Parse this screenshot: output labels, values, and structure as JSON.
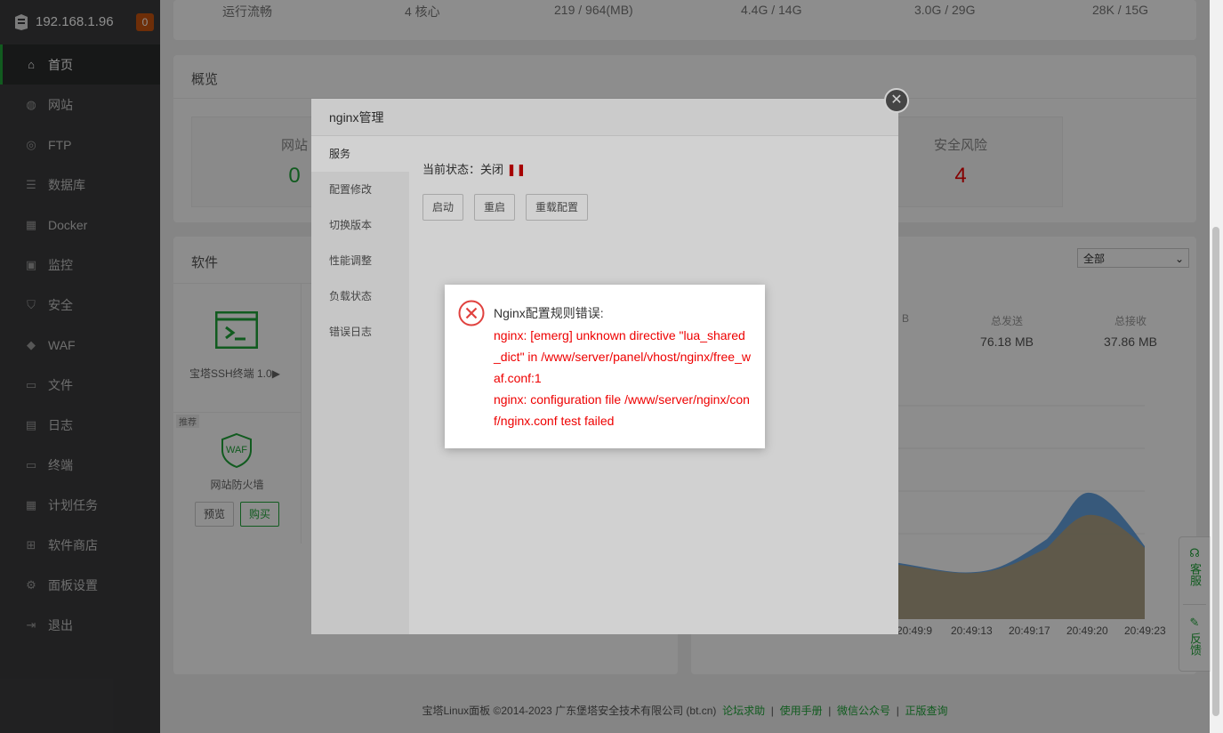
{
  "sidebar": {
    "host": "192.168.1.96",
    "badge": "0",
    "items": [
      {
        "label": "首页",
        "icon": "home-icon"
      },
      {
        "label": "网站",
        "icon": "globe-icon"
      },
      {
        "label": "FTP",
        "icon": "ftp-icon"
      },
      {
        "label": "数据库",
        "icon": "database-icon"
      },
      {
        "label": "Docker",
        "icon": "docker-icon"
      },
      {
        "label": "监控",
        "icon": "monitor-icon"
      },
      {
        "label": "安全",
        "icon": "shield-icon"
      },
      {
        "label": "WAF",
        "icon": "waf-icon"
      },
      {
        "label": "文件",
        "icon": "folder-icon"
      },
      {
        "label": "日志",
        "icon": "log-icon"
      },
      {
        "label": "终端",
        "icon": "terminal-icon"
      },
      {
        "label": "计划任务",
        "icon": "calendar-icon"
      },
      {
        "label": "软件商店",
        "icon": "apps-icon"
      },
      {
        "label": "面板设置",
        "icon": "gear-icon"
      },
      {
        "label": "退出",
        "icon": "logout-icon"
      }
    ]
  },
  "sysinfo": {
    "status": "运行流畅",
    "cpu": "4 核心",
    "memory": "219 / 964(MB)",
    "disk1": "4.4G / 14G",
    "disk2": "3.0G / 29G",
    "disk3": "28K / 15G"
  },
  "overview": {
    "title": "概览",
    "sites_label": "网站",
    "sites_value": "0",
    "risk_label": "安全风险",
    "risk_value": "4"
  },
  "software": {
    "title": "软件",
    "ssh_name": "宝塔SSH终端 1.0▶",
    "recommend_tag": "推荐",
    "waf_name": "网站防火墙",
    "preview_btn": "预览",
    "buy_btn": "购买"
  },
  "traffic": {
    "filter": "全部",
    "sent_label": "总发送",
    "sent_value": "76.18 MB",
    "recv_label": "总接收",
    "recv_value": "37.86 MB",
    "partial_value": "B",
    "times": [
      "20:49:9",
      "20:49:13",
      "20:49:17",
      "20:49:20",
      "20:49:23"
    ]
  },
  "modal": {
    "title": "nginx管理",
    "tabs": [
      "服务",
      "配置修改",
      "切换版本",
      "性能调整",
      "负载状态",
      "错误日志"
    ],
    "status_label": "当前状态：关闭",
    "buttons": [
      "启动",
      "重启",
      "重载配置"
    ]
  },
  "error": {
    "title": "Nginx配置规则错误:",
    "line1": "nginx: [emerg] unknown directive \"lua_shared_dict\" in /www/server/panel/vhost/nginx/free_waf.conf:1",
    "line2": "nginx: configuration file /www/server/nginx/conf/nginx.conf test failed"
  },
  "footer": {
    "copyright": "宝塔Linux面板 ©2014-2023 广东堡塔安全技术有限公司 (bt.cn)",
    "links": [
      "论坛求助",
      "使用手册",
      "微信公众号",
      "正版查询"
    ]
  },
  "float": {
    "service": "客服",
    "feedback": "反馈"
  },
  "colors": {
    "accent": "#20a53a",
    "danger": "#e00000",
    "sidebar": "#3b3c3d"
  }
}
